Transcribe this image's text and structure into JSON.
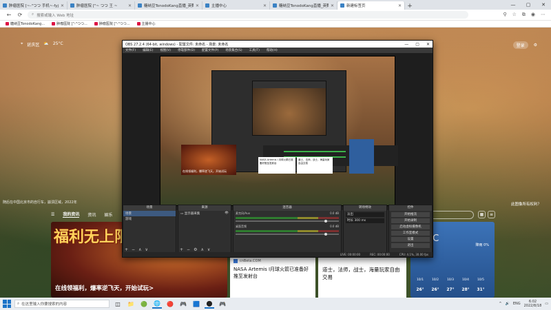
{
  "browser": {
    "tabs": [
      {
        "title": "肿瘤医院 [~-\"つつ 手机~-fyj",
        "active": false
      },
      {
        "title": "肿瘤医院 [\"~ つつ 王 ~",
        "active": false
      },
      {
        "title": "糖纳豆TonodoKang直播_英野岩",
        "active": false
      },
      {
        "title": "主播中心",
        "active": false
      },
      {
        "title": "糖纳豆TonodoKang直播_英野岩",
        "active": false
      },
      {
        "title": "新建标签页",
        "active": true
      }
    ],
    "new_tab": "+",
    "window_controls": {
      "min": "—",
      "max": "▢",
      "close": "✕"
    },
    "address_placeholder": "搜索或输入 Web 地址",
    "favorites": [
      {
        "label": "糖纳豆TonodoKang..."
      },
      {
        "label": "肿瘤医院 [\"-\"つつ..."
      },
      {
        "label": "肿瘤医院 [\"-\"つつ..."
      },
      {
        "label": "主播中心"
      }
    ]
  },
  "ntp": {
    "location": "延庆区",
    "temperature": "25°C",
    "signin": "登录",
    "caption_left": "随后在中国北京市的自行车，崩溃区域，2022年",
    "caption_right": "此图像所有权利？",
    "feed_nav": [
      "我的资讯",
      "资讯",
      "娱乐"
    ],
    "feed_search_placeholder": "",
    "main_card": {
      "headline": "福利无上限",
      "caption": "在线领福利，爆率逆飞天，开始试玩>"
    },
    "news_card": {
      "source": "cnBeta.COM",
      "headline": "NASA Artemis I月球火箭已准备好推至发射台"
    },
    "game_card": {
      "headline": "道士，法师，战士，海量玩家自由交易"
    },
    "weather": {
      "now": "25 °C",
      "humidity": "降雨 0%",
      "days": [
        {
          "d": "10/1",
          "t": "26°"
        },
        {
          "d": "10/2",
          "t": "26°"
        },
        {
          "d": "10/3",
          "t": "27°"
        },
        {
          "d": "10/4",
          "t": "28°"
        },
        {
          "d": "10/5",
          "t": "31°"
        }
      ]
    }
  },
  "obs": {
    "title": "OBS 27.2.4 (64-bit, windows) - 配置文件: 未命名 - 场景: 未命名",
    "menu": [
      "文件(F)",
      "编辑(E)",
      "视图(V)",
      "停靠部件(D)",
      "配置文件(P)",
      "场景集合(S)",
      "工具(T)",
      "帮助(H)"
    ],
    "scene_label": "未选择源",
    "preview_buttons": [
      "属性",
      "滤镜"
    ],
    "preview_news": "NASA Artemis I 月球火箭已准备好推至发射台",
    "preview_news2": "道士，法师，战士，海量玩家自由交易",
    "preview_banner": "在线领福利，爆率逆飞天，开始试玩",
    "docks": {
      "scenes": {
        "title": "场景",
        "items": [
          "场景",
          "游戏"
        ]
      },
      "sources": {
        "title": "来源",
        "items": [
          "显示器采集"
        ]
      },
      "mixer": {
        "title": "混音器",
        "channels": [
          {
            "name": "麦克风/Aux",
            "db": "0.0 dB"
          },
          {
            "name": "桌面音频",
            "db": "0.0 dB"
          }
        ]
      },
      "transitions": {
        "title": "转场特效",
        "type": "淡出",
        "duration_label": "时长",
        "duration": "300 ms"
      },
      "controls": {
        "title": "控件",
        "buttons": [
          "开始推流",
          "开始录制",
          "启动虚拟摄像机",
          "工作室模式",
          "设置",
          "退出"
        ]
      }
    },
    "status": [
      "LIVE: 00:00:00",
      "REC: 00:00:00",
      "CPU: 4.1%, 30.00 fps"
    ]
  },
  "taskbar": {
    "search_placeholder": "在这里输入你要搜索的内容",
    "apps": [
      "◫",
      "📁",
      "🟢",
      "🌐",
      "🔴",
      "🎮",
      "🟦",
      "⬤",
      "🎮"
    ],
    "tray": [
      "^",
      "🔊",
      "ENG"
    ],
    "time": "6:02",
    "date": "2022/8/18"
  }
}
